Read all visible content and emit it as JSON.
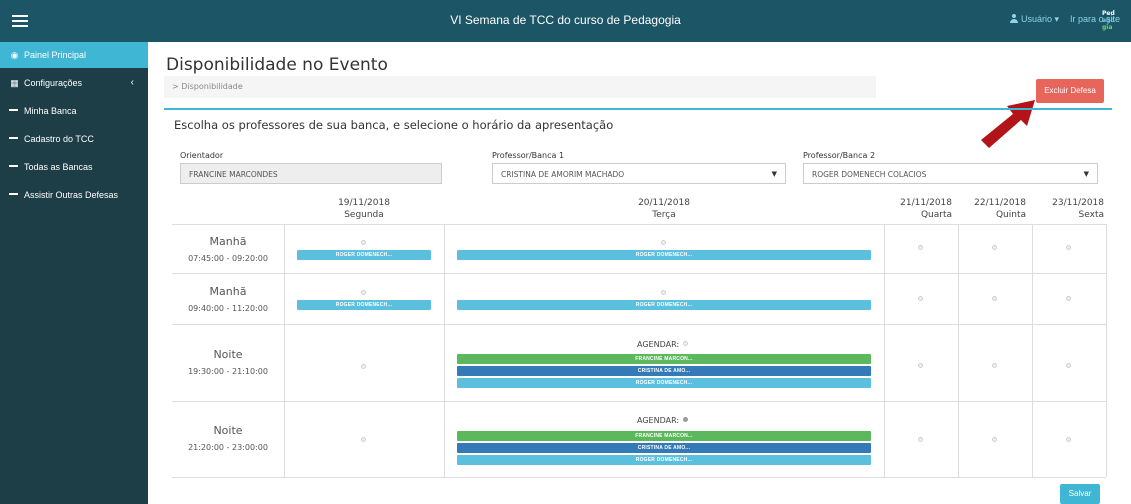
{
  "header": {
    "title": "VI Semana de TCC do curso de Pedagogia",
    "user_label": "Usuário",
    "user_caret": "▾",
    "site_link": "Ir para o site",
    "logo": [
      "Ped",
      "ago",
      "gia"
    ]
  },
  "sidebar": {
    "items": [
      {
        "label": "Painel Principal",
        "icon": "dashboard-icon",
        "active": true
      },
      {
        "label": "Configurações",
        "icon": "table-icon",
        "chevron": "‹"
      },
      {
        "label": "Minha Banca",
        "icon": "dash-icon"
      },
      {
        "label": "Cadastro do TCC",
        "icon": "dash-icon"
      },
      {
        "label": "Todas as Bancas",
        "icon": "dash-icon"
      },
      {
        "label": "Assistir Outras Defesas",
        "icon": "dash-icon"
      }
    ]
  },
  "page": {
    "title": "Disponibilidade no Evento",
    "breadcrumb": "> Disponibilidade",
    "delete_button": "Excluir Defesa",
    "heading": "Escolha os professores de sua banca, e selecione o horário da apresentação",
    "save_button": "Salvar"
  },
  "fields": {
    "orientador": {
      "label": "Orientador",
      "value": "FRANCINE MARCONDES"
    },
    "banca1": {
      "label": "Professor/Banca 1",
      "value": "CRISTINA DE AMORIM MACHADO"
    },
    "banca2": {
      "label": "Professor/Banca 2",
      "value": "ROGER DOMENECH COLACIOS"
    },
    "caret": "▼"
  },
  "schedule": {
    "days": [
      {
        "date": "19/11/2018",
        "weekday": "Segunda"
      },
      {
        "date": "20/11/2018",
        "weekday": "Terça"
      },
      {
        "date": "21/11/2018",
        "weekday": "Quarta"
      },
      {
        "date": "22/11/2018",
        "weekday": "Quinta"
      },
      {
        "date": "23/11/2018",
        "weekday": "Sexta"
      }
    ],
    "slots": [
      {
        "name": "Manhã",
        "time": "07:45:00 - 09:20:00"
      },
      {
        "name": "Manhã",
        "time": "09:40:00 - 11:20:00"
      },
      {
        "name": "Noite",
        "time": "19:30:00 - 21:10:00"
      },
      {
        "name": "Noite",
        "time": "21:20:00 - 23:00:00"
      }
    ],
    "tags": {
      "roger": "ROGER DOMENECH...",
      "francine": "FRANCINE MARCON...",
      "cristina": "CRISTINA DE AMO..."
    },
    "agendar": "AGENDAR:"
  },
  "colors": {
    "topbar": "#1b5566",
    "sidebar": "#1d3d47",
    "accent": "#3fb6d3",
    "danger": "#e8655b",
    "arrow": "#b3141a"
  }
}
